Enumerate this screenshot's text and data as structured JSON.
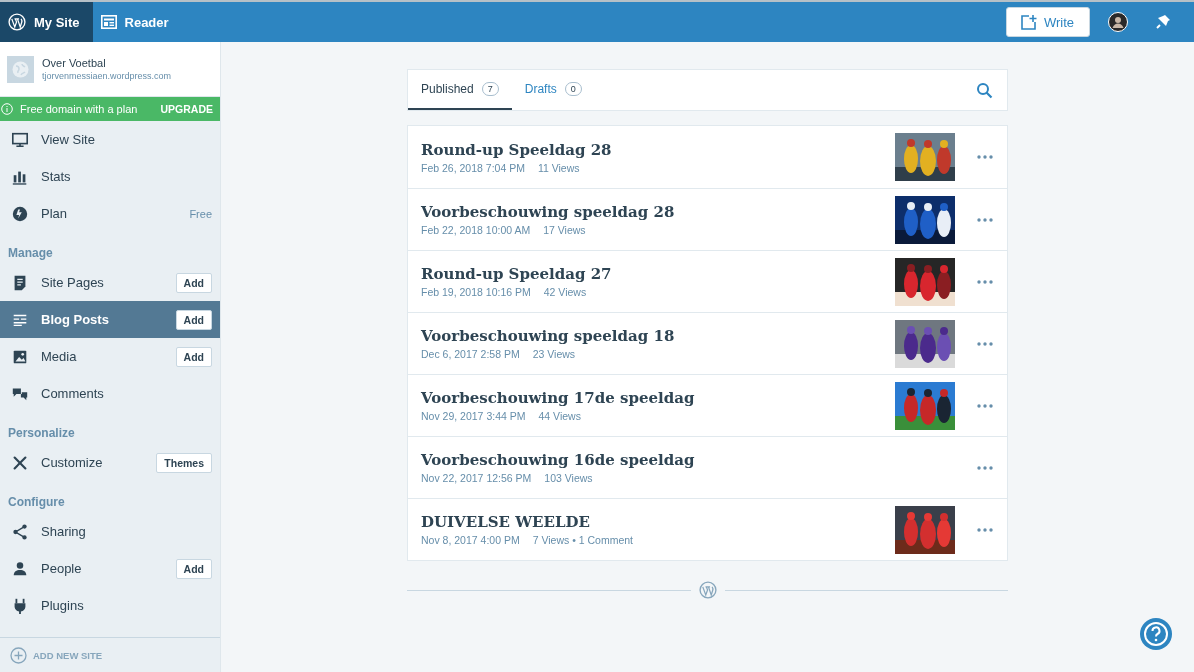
{
  "masterbar": {
    "tabs": [
      {
        "label": "My Site",
        "selected": true
      },
      {
        "label": "Reader",
        "selected": false
      }
    ],
    "write_button": "Write"
  },
  "site": {
    "name": "Over Voetbal",
    "url": "tjorvenmessiaen.wordpress.com"
  },
  "notice": {
    "text": "Free domain with a plan",
    "action": "UPGRADE"
  },
  "sidebar": {
    "sections": [
      {
        "items": [
          {
            "label": "View Site",
            "selected": false
          },
          {
            "label": "Stats",
            "selected": false
          },
          {
            "label": "Plan",
            "selected": false,
            "badge": "Free"
          }
        ]
      },
      {
        "heading": "Manage",
        "items": [
          {
            "label": "Site Pages",
            "selected": false,
            "button": "Add"
          },
          {
            "label": "Blog Posts",
            "selected": true,
            "button": "Add"
          },
          {
            "label": "Media",
            "selected": false,
            "button": "Add"
          },
          {
            "label": "Comments",
            "selected": false
          }
        ]
      },
      {
        "heading": "Personalize",
        "items": [
          {
            "label": "Customize",
            "selected": false,
            "button": "Themes"
          }
        ]
      },
      {
        "heading": "Configure",
        "items": [
          {
            "label": "Sharing",
            "selected": false
          },
          {
            "label": "People",
            "selected": false,
            "button": "Add"
          },
          {
            "label": "Plugins",
            "selected": false
          }
        ]
      }
    ],
    "footer": "ADD NEW SITE"
  },
  "post_tabs": [
    {
      "label": "Published",
      "count": "7",
      "selected": true
    },
    {
      "label": "Drafts",
      "count": "0",
      "selected": false
    }
  ],
  "posts": [
    {
      "title": "Round-up Speeldag 28",
      "date": "Feb 26, 2018 7:04 PM",
      "stats": "11 Views"
    },
    {
      "title": "Voorbeschouwing speeldag 28",
      "date": "Feb 22, 2018 10:00 AM",
      "stats": "17 Views"
    },
    {
      "title": "Round-up Speeldag 27",
      "date": "Feb 19, 2018 10:16 PM",
      "stats": "42 Views"
    },
    {
      "title": "Voorbeschouwing speeldag 18",
      "date": "Dec 6, 2017 2:58 PM",
      "stats": "23 Views"
    },
    {
      "title": "Voorbeschouwing 17de speeldag",
      "date": "Nov 29, 2017 3:44 PM",
      "stats": "44 Views"
    },
    {
      "title": "Voorbeschouwing 16de speeldag",
      "date": "Nov 22, 2017 12:56 PM",
      "stats": "103 Views"
    },
    {
      "title": "DUIVELSE WEELDE",
      "date": "Nov 8, 2017 4:00 PM",
      "stats": "7 Views • 1 Comment"
    }
  ]
}
